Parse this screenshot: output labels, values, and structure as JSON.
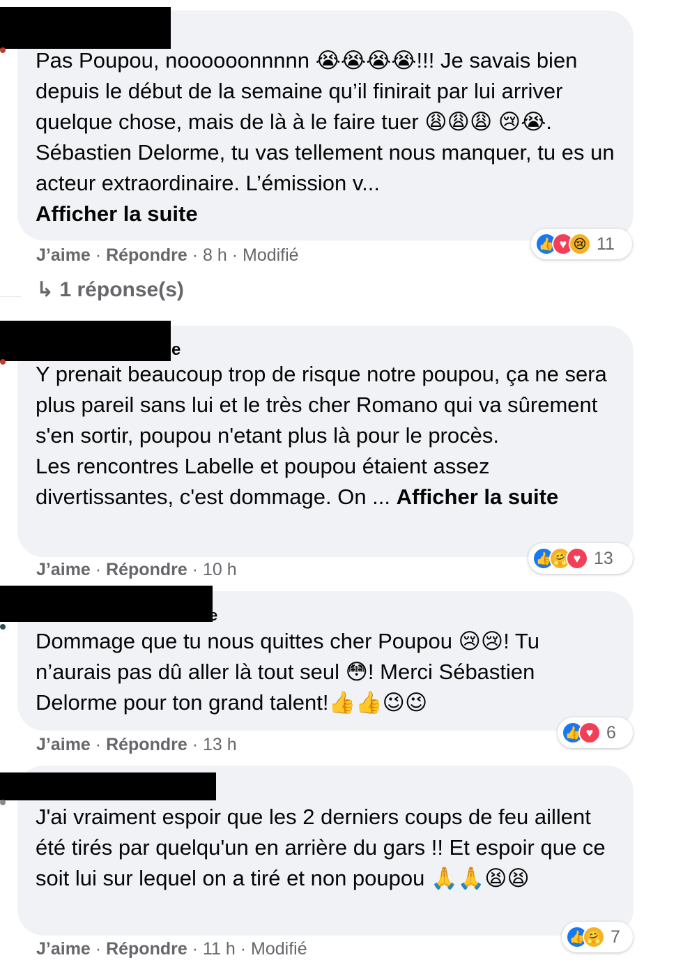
{
  "comments": [
    {
      "author_fragment": "",
      "text": "Pas Poupou, noooooonnnnn 😭😭😭😭!!! Je savais bien depuis le début de la semaine qu’il finirait par lui arriver quelque chose, mais de là à le faire tuer 😩😩😩 😢😭. Sébastien Delorme, tu vas tellement nous manquer, tu es un acteur extraordinaire. L’émission v...",
      "see_more": "Afficher la suite",
      "like": "J’aime",
      "reply": "Répondre",
      "time": "8 h",
      "edited": "Modifié",
      "reaction_count": "11",
      "reaction_icons": [
        "like-icon",
        "love-icon",
        "sad-icon"
      ]
    },
    {
      "author_fragment": "e",
      "text": "Y prenait beaucoup trop de risque notre poupou, ça ne sera plus pareil sans lui et le très cher Romano qui va sûrement s'en sortir, poupou n'etant plus là pour le procès.\nLes rencontres Labelle et poupou étaient assez divertissantes, c'est dommage. On ... ",
      "see_more": "Afficher la suite",
      "like": "J’aime",
      "reply": "Répondre",
      "time": "10 h",
      "edited": "",
      "reaction_count": "13",
      "reaction_icons": [
        "like-icon",
        "care-icon",
        "love-icon"
      ]
    },
    {
      "author_fragment": "e",
      "text": "Dommage que tu nous quittes cher Poupou 😢😢! Tu n’aurais pas dû aller là tout seul 😳! Merci Sébastien Delorme pour ton grand talent!👍👍😉😉",
      "see_more": "",
      "like": "J’aime",
      "reply": "Répondre",
      "time": "13 h",
      "edited": "",
      "reaction_count": "6",
      "reaction_icons": [
        "like-icon",
        "love-icon"
      ]
    },
    {
      "author_fragment": "",
      "text": "J'ai vraiment espoir que les 2 derniers coups de feu aillent été tirés par quelqu'un en arrière du gars !! Et espoir que ce soit lui sur lequel on a tiré et non poupou 🙏🙏😫😫",
      "see_more": "",
      "like": "J’aime",
      "reply": "Répondre",
      "time": "11 h",
      "edited": "Modifié",
      "reaction_count": "7",
      "reaction_icons": [
        "like-icon",
        "care-icon"
      ]
    }
  ],
  "replies_link": "1 réponse(s)",
  "separator": "·",
  "colors": {
    "bubble": "#f0f2f5",
    "secondary_text": "#65676b",
    "like_blue": "#1877f2",
    "love_red": "#f33e58"
  }
}
